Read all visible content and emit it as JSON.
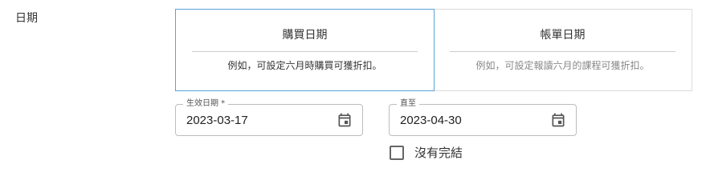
{
  "section": {
    "label": "日期"
  },
  "date_type_options": [
    {
      "title": "購買日期",
      "description": "例如，可設定六月時購買可獲折扣。",
      "selected": true
    },
    {
      "title": "帳單日期",
      "description": "例如，可設定報讀六月的課程可獲折扣。",
      "selected": false
    }
  ],
  "effective_date": {
    "label": "生效日期 *",
    "value": "2023-03-17",
    "icon": "calendar-icon"
  },
  "end_date": {
    "label": "直至",
    "value": "2023-04-30",
    "icon": "calendar-icon"
  },
  "no_end": {
    "label": "沒有完結",
    "checked": false
  },
  "colors": {
    "selected_border": "#5aa3d6",
    "default_border": "#dcdcdc",
    "muted_text": "#888888"
  }
}
